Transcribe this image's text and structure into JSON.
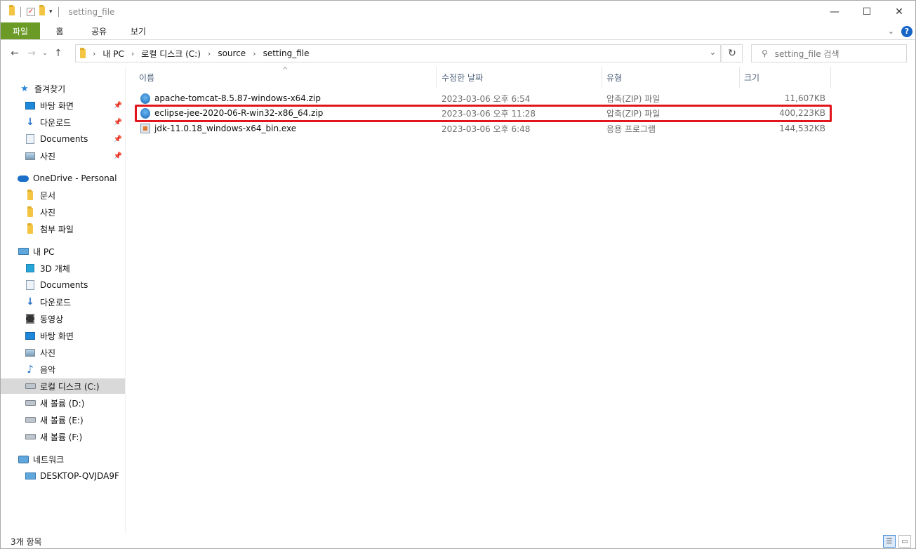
{
  "window": {
    "title": "setting_file",
    "controls": {
      "minimize": "—",
      "maximize": "☐",
      "close": "✕"
    }
  },
  "ribbon": {
    "tabs": [
      "파일",
      "홈",
      "공유",
      "보기"
    ]
  },
  "address": {
    "crumbs": [
      "내 PC",
      "로컬 디스크 (C:)",
      "source",
      "setting_file"
    ],
    "search_placeholder": "setting_file 검색"
  },
  "nav": {
    "quick_access": "즐겨찾기",
    "quick_items": [
      "바탕 화면",
      "다운로드",
      "Documents",
      "사진"
    ],
    "onedrive": "OneDrive - Personal",
    "onedrive_items": [
      "문서",
      "사진",
      "첨부 파일"
    ],
    "this_pc": "내 PC",
    "pc_items": [
      "3D 개체",
      "Documents",
      "다운로드",
      "동영상",
      "바탕 화면",
      "사진",
      "음악",
      "로컬 디스크 (C:)",
      "새 볼륨 (D:)",
      "새 볼륨 (E:)",
      "새 볼륨 (F:)"
    ],
    "network": "네트워크",
    "network_items": [
      "DESKTOP-QVJDA9F"
    ]
  },
  "list": {
    "columns": {
      "name": "이름",
      "date": "수정한 날짜",
      "type": "유형",
      "size": "크기"
    },
    "files": [
      {
        "name": "apache-tomcat-8.5.87-windows-x64.zip",
        "date": "2023-03-06 오후 6:54",
        "type": "압축(ZIP) 파일",
        "size": "11,607KB",
        "icon": "zip-icon"
      },
      {
        "name": "eclipse-jee-2020-06-R-win32-x86_64.zip",
        "date": "2023-03-06 오후 11:28",
        "type": "압축(ZIP) 파일",
        "size": "400,223KB",
        "icon": "zip-icon"
      },
      {
        "name": "jdk-11.0.18_windows-x64_bin.exe",
        "date": "2023-03-06 오후 6:48",
        "type": "응용 프로그램",
        "size": "144,532KB",
        "icon": "exe-icon"
      }
    ]
  },
  "status": {
    "item_count": "3개 항목"
  },
  "colors": {
    "file_tab": "#6b9a26",
    "highlight": "#e2151c",
    "selected_nav": "#d9d9d9"
  }
}
